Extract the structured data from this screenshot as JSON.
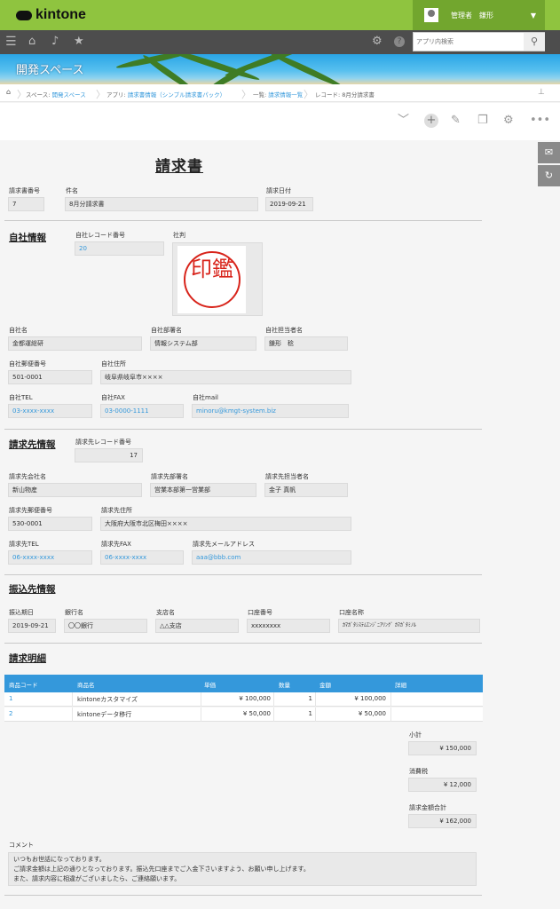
{
  "app": {
    "logo": "kintone"
  },
  "user": {
    "name": "管理者　鎌形"
  },
  "search": {
    "placeholder": "アプリ内検索"
  },
  "banner": {
    "title": "開発スペース"
  },
  "breadcrumb": {
    "space_prefix": "スペース: ",
    "space": "開発スペース",
    "app_prefix": "アプリ: ",
    "app": "請求書情報（シンプル請求書パック）",
    "list_prefix": "一覧: ",
    "list": "請求情報一覧",
    "record": "レコード: 8月分請求書"
  },
  "toolbar_icons": [
    "chevron-down-icon",
    "plus-icon",
    "edit-icon",
    "copy-icon",
    "gear-icon",
    "more-icon"
  ],
  "doc_title": "請求書",
  "header": {
    "invoice_no_label": "請求書番号",
    "invoice_no": "7",
    "subject_label": "件名",
    "subject": "8月分請求書",
    "date_label": "請求日付",
    "date": "2019-09-21"
  },
  "company": {
    "section": "自社情報",
    "record_no_label": "自社レコード番号",
    "record_no": "20",
    "seal_label": "社判",
    "seal_text": "印鑑",
    "name_label": "自社名",
    "name": "金都運総研",
    "dept_label": "自社部署名",
    "dept": "情報システム部",
    "person_label": "自社担当者名",
    "person": "鎌形　稔",
    "zip_label": "自社郵便番号",
    "zip": "501-0001",
    "address_label": "自社住所",
    "address": "岐阜県岐阜市××××",
    "tel_label": "自社TEL",
    "tel": "03-xxxx-xxxx",
    "fax_label": "自社FAX",
    "fax": "03-0000-1111",
    "mail_label": "自社mail",
    "mail": "minoru@kmgt-system.biz"
  },
  "client": {
    "section": "請求先情報",
    "record_no_label": "請求先レコード番号",
    "record_no": "17",
    "name_label": "請求先会社名",
    "name": "新山物産",
    "dept_label": "請求先部署名",
    "dept": "営業本部第一営業部",
    "person_label": "請求先担当者名",
    "person": "金子 真帆",
    "zip_label": "請求先郵便番号",
    "zip": "530-0001",
    "address_label": "請求先住所",
    "address": "大阪府大阪市北区梅田××××",
    "tel_label": "請求先TEL",
    "tel": "06-xxxx-xxxx",
    "fax_label": "請求先FAX",
    "fax": "06-xxxx-xxxx",
    "mail_label": "請求先メールアドレス",
    "mail": "aaa@bbb.com"
  },
  "transfer": {
    "section": "振込先情報",
    "due_label": "振込期日",
    "due": "2019-09-21",
    "bank_label": "銀行名",
    "bank": "〇〇銀行",
    "branch_label": "支店名",
    "branch": "△△支店",
    "account_label": "口座番号",
    "account": "xxxxxxxx",
    "holder_label": "口座名称",
    "holder": "ｶﾏｶﾞﾀｼｽﾃﾑｴﾝｼﾞﾆｱﾘﾝｸﾞ ｶﾏｶﾞﾀﾐﾉﾙ"
  },
  "details": {
    "section": "請求明細",
    "columns": [
      "商品コード",
      "商品名",
      "単価",
      "数量",
      "金額",
      "詳細"
    ],
    "rows": [
      {
        "code": "1",
        "name": "kintoneカスタマイズ",
        "price": "¥ 100,000",
        "qty": "1",
        "amount": "¥ 100,000",
        "detail": ""
      },
      {
        "code": "2",
        "name": "kintoneデータ移行",
        "price": "¥ 50,000",
        "qty": "1",
        "amount": "¥ 50,000",
        "detail": ""
      }
    ]
  },
  "totals": {
    "subtotal_label": "小計",
    "subtotal": "¥ 150,000",
    "tax_label": "消費税",
    "tax": "¥ 12,000",
    "total_label": "請求金額合計",
    "total": "¥ 162,000"
  },
  "comment": {
    "label": "コメント",
    "lines": [
      "いつもお世話になっております。",
      "ご請求金額は上記の通りとなっております。振込先口座までご入金下さいますよう、お願い申し上げます。",
      "また、請求内容に相違がございましたら、ご連絡願います。"
    ]
  }
}
